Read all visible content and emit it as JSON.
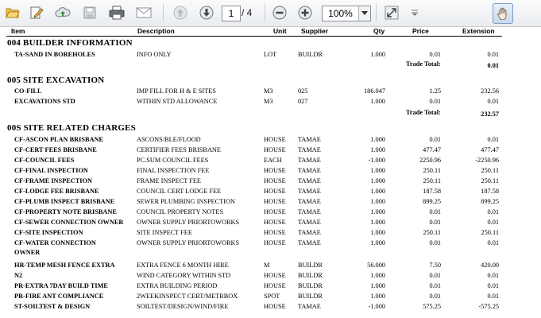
{
  "toolbar": {
    "current_page": "1",
    "page_total": "/ 4",
    "zoom": "100%"
  },
  "columns": {
    "item": "Item",
    "description": "Description",
    "unit": "Unit",
    "supplier": "Supplier",
    "qty": "Qty",
    "price": "Price",
    "extension": "Extension"
  },
  "sections": [
    {
      "title": "004   BUILDER INFORMATION",
      "rows": [
        {
          "item": "TA-SAND IN BOREHOLES",
          "description": "INFO ONLY",
          "unit": "LOT",
          "supplier": "BUILDR",
          "qty": "1.000",
          "price": "0.01",
          "extension": "0.01"
        }
      ],
      "trade_total_label": "Trade Total:",
      "trade_total": "0.01"
    },
    {
      "title": "005   SITE EXCAVATION",
      "rows": [
        {
          "item": "CO-FILL",
          "description": "IMP FILL FOR H & E SITES",
          "unit": "M3",
          "supplier": "025",
          "qty": "186.047",
          "price": "1.25",
          "extension": "232.56"
        },
        {
          "item": "EXCAVATIONS STD",
          "description": "WITHIN STD ALLOWANCE",
          "unit": "M3",
          "supplier": "027",
          "qty": "1.000",
          "price": "0.01",
          "extension": "0.01"
        }
      ],
      "trade_total_label": "Trade Total:",
      "trade_total": "232.57"
    },
    {
      "title": "00S   SITE RELATED CHARGES",
      "rows": [
        {
          "item": "CF-ASCON PLAN BRISBANE",
          "description": "ASCONS/BLE/FLOOD",
          "unit": "HOUSE",
          "supplier": "TAMAE",
          "qty": "1.000",
          "price": "0.01",
          "extension": "0.01"
        },
        {
          "item": "CF-CERT FEES BRISBANE",
          "description": "CERTIFIER FEES BRISBANE",
          "unit": "HOUSE",
          "supplier": "TAMAE",
          "qty": "1.000",
          "price": "477.47",
          "extension": "477.47"
        },
        {
          "item": "CF-COUNCIL FEES",
          "description": "PC.SUM COUNCIL FEES",
          "unit": "EACH",
          "supplier": "TAMAE",
          "qty": "-1.000",
          "price": "2250.96",
          "extension": "-2250.96"
        },
        {
          "item": "CF-FINAL INSPECTION",
          "description": "FINAL INSPECTION FEE",
          "unit": "HOUSE",
          "supplier": "TAMAE",
          "qty": "1.000",
          "price": "250.11",
          "extension": "250.11"
        },
        {
          "item": "CF-FRAME INSPECTION",
          "description": "FRAME INSPECT FEE",
          "unit": "HOUSE",
          "supplier": "TAMAE",
          "qty": "1.000",
          "price": "250.11",
          "extension": "250.11"
        },
        {
          "item": "CF-LODGE FEE BRISBANE",
          "description": "COUNCIL CERT LODGE FEE",
          "unit": "HOUSE",
          "supplier": "TAMAE",
          "qty": "1.000",
          "price": "187.58",
          "extension": "187.58"
        },
        {
          "item": "CF-PLUMB INSPECT BRISBANE",
          "description": "SEWER PLUMBING INSPECTION",
          "unit": "HOUSE",
          "supplier": "TAMAE",
          "qty": "1.000",
          "price": "899.25",
          "extension": "899.25"
        },
        {
          "item": "CF-PROPERTY NOTE BRISBANE",
          "description": "COUNCIL PROPERTY NOTES",
          "unit": "HOUSE",
          "supplier": "TAMAE",
          "qty": "1.000",
          "price": "0.01",
          "extension": "0.01"
        },
        {
          "item": "CF-SEWER CONNECTION OWNER",
          "description": "OWNER SUPPLY PRIORTOWORKS",
          "unit": "HOUSE",
          "supplier": "TAMAE",
          "qty": "1.000",
          "price": "0.01",
          "extension": "0.01"
        },
        {
          "item": "CF-SITE INSPECTION",
          "description": "SITE INSPECT FEE",
          "unit": "HOUSE",
          "supplier": "TAMAE",
          "qty": "1.000",
          "price": "250.11",
          "extension": "250.11"
        },
        {
          "item": "CF-WATER CONNECTION",
          "item2": "OWNER",
          "description": "OWNER SUPPLY PRIORTOWORKS",
          "unit": "HOUSE",
          "supplier": "TAMAE",
          "qty": "1.000",
          "price": "0.01",
          "extension": "0.01"
        },
        {
          "item": "HR-TEMP MESH FENCE EXTRA",
          "description": "EXTRA FENCE 6 MONTH HIRE",
          "unit": "M",
          "supplier": "BUILDR",
          "qty": "56.000",
          "price": "7.50",
          "extension": "420.00"
        },
        {
          "item": "N2",
          "description": "WIND CATEGORY WITHIN STD",
          "unit": "HOUSE",
          "supplier": "BUILDR",
          "qty": "1.000",
          "price": "0.01",
          "extension": "0.01"
        },
        {
          "item": "PR-EXTRA  7DAY BUILD TIME",
          "description": "EXTRA BUILDING PERIOD",
          "unit": "HOUSE",
          "supplier": "BUILDR",
          "qty": "1.000",
          "price": "0.01",
          "extension": "0.01"
        },
        {
          "item": "PR-FIRE ANT COMPLIANCE",
          "description": "2WEEKINSPECT CERT/METRBOX",
          "unit": "SPOT",
          "supplier": "BUILDR",
          "qty": "1.000",
          "price": "0.01",
          "extension": "0.01"
        },
        {
          "item": "ST-SOILTEST & DESIGN",
          "description": "SOILTEST/DESIGN/WIND/FIRE",
          "unit": "HOUSE",
          "supplier": "TAMAE",
          "qty": "-1.000",
          "price": "575.25",
          "extension": "-575.25"
        }
      ]
    }
  ]
}
